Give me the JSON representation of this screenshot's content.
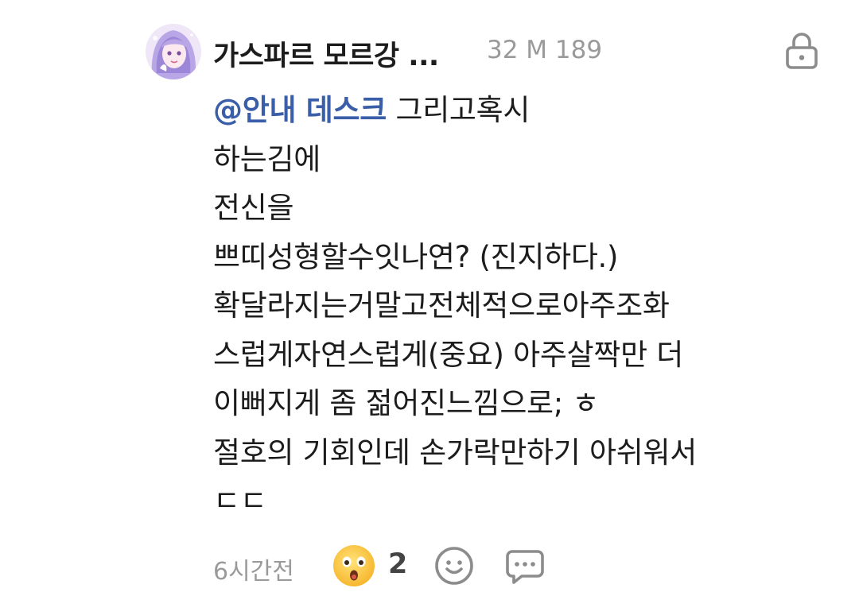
{
  "comment": {
    "author": "가스파르 모르강 ...",
    "meta": "32 M 189",
    "mention": "@안내 데스크",
    "lines": [
      "그리고혹시",
      "하는김에",
      "전신을",
      "쁘띠성형할수잇나연? (진지하다.)",
      "확달라지는거말고전체적으로아주조화",
      "스럽게자연스럽게(중요) 아주살짝만 더",
      "이뻐지게 좀 젊어진느낌으로; ㅎ",
      "절호의 기회인데 손가락만하기 아쉬워서",
      "ㄷㄷ"
    ],
    "time": "6시간전",
    "reaction_count": "2"
  },
  "icons": {
    "avatar": "avatar",
    "lock": "lock-icon",
    "reaction": "surprised-face-emoji",
    "add_reaction": "smiley-icon",
    "reply": "speech-bubble-icon"
  },
  "colors": {
    "mention": "#3a5fa8",
    "meta": "#9a9a9a",
    "text": "#1c1c1c"
  }
}
